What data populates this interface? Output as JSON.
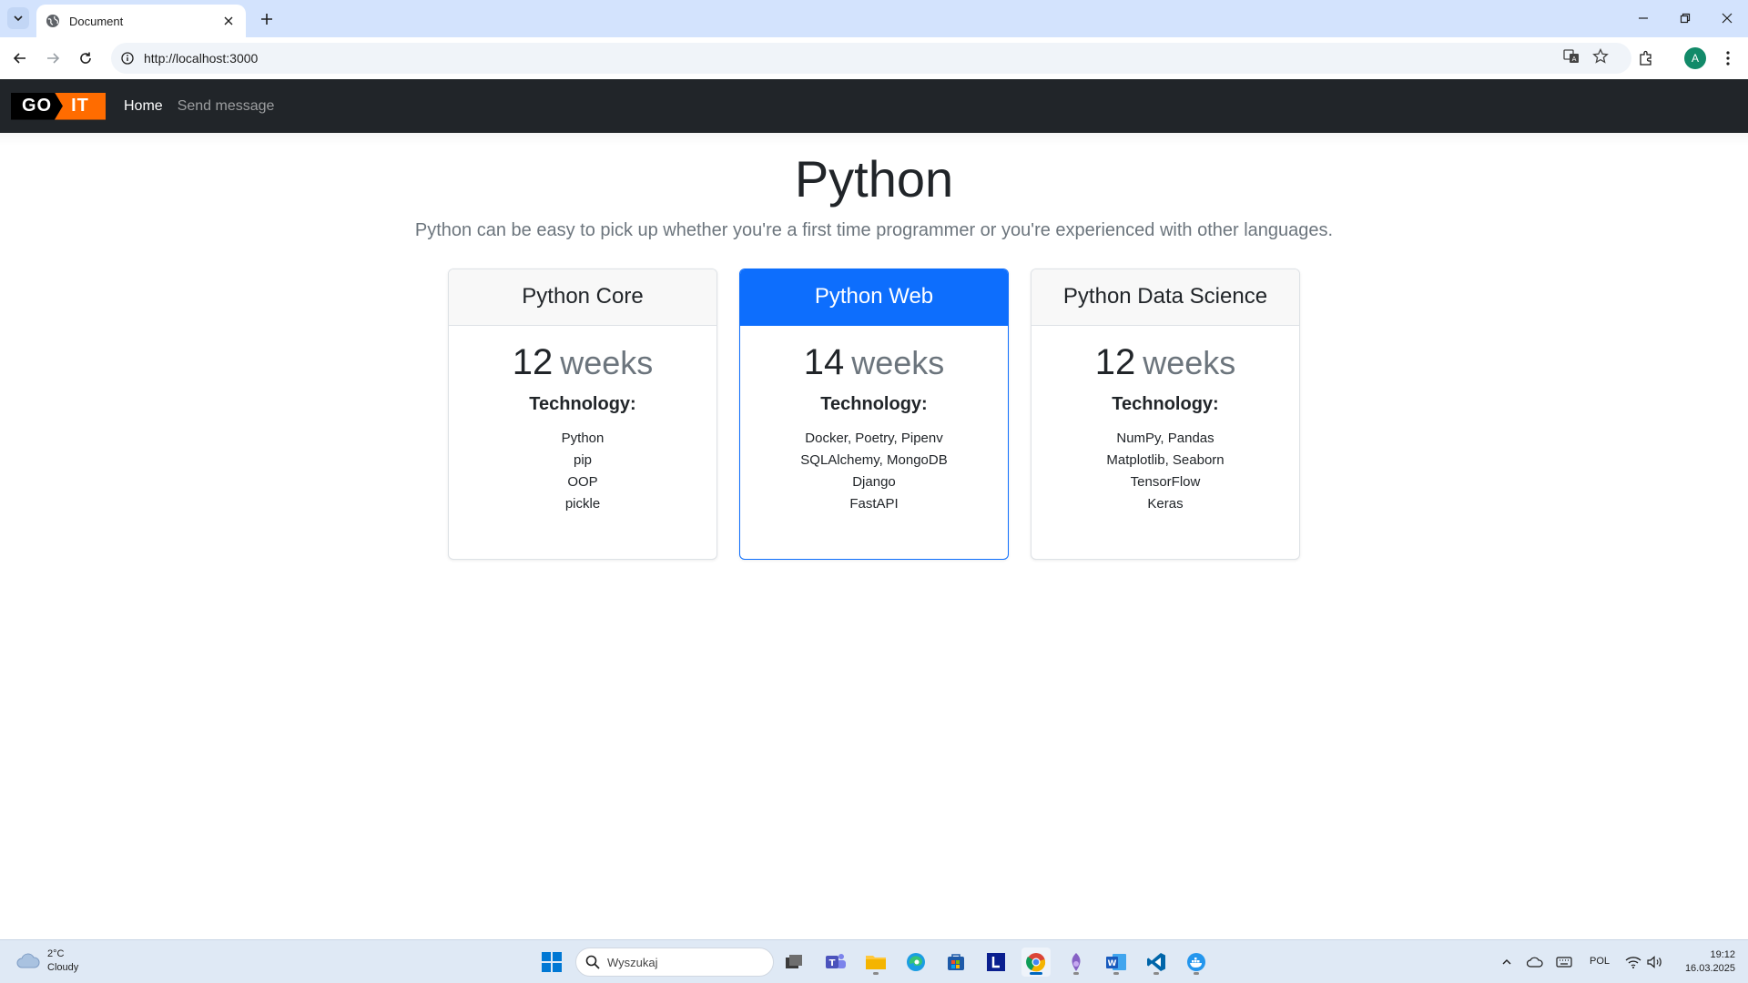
{
  "browser": {
    "tab": {
      "title": "Document"
    },
    "address": {
      "url": "http://localhost:3000"
    }
  },
  "navbar": {
    "logo": {
      "go": "GO",
      "it": "IT"
    },
    "links": [
      {
        "label": "Home",
        "active": true
      },
      {
        "label": "Send message",
        "active": false
      }
    ]
  },
  "hero": {
    "title": "Python",
    "lead": "Python can be easy to pick up whether you're a first time programmer or you're experienced with other languages."
  },
  "cards": [
    {
      "title": "Python Core",
      "duration": "12",
      "unit": "weeks",
      "tech_label": "Technology:",
      "tech": [
        "Python",
        "pip",
        "OOP",
        "pickle"
      ]
    },
    {
      "title": "Python Web",
      "duration": "14",
      "unit": "weeks",
      "tech_label": "Technology:",
      "tech": [
        "Docker, Poetry, Pipenv",
        "SQLAlchemy, MongoDB",
        "Django",
        "FastAPI"
      ],
      "featured": true
    },
    {
      "title": "Python Data Science",
      "duration": "12",
      "unit": "weeks",
      "tech_label": "Technology:",
      "tech": [
        "NumPy, Pandas",
        "Matplotlib, Seaborn",
        "TensorFlow",
        "Keras"
      ]
    }
  ],
  "taskbar": {
    "weather": {
      "temp": "2°C",
      "condition": "Cloudy"
    },
    "search_placeholder": "Wyszukaj",
    "language": "POL",
    "time": "19:12",
    "date": "16.03.2025"
  },
  "colors": {
    "navbar_bg": "#212529",
    "logo_accent": "#ff6c00",
    "featured": "#0d6efd",
    "chrome_tabstrip": "#d3e3fd"
  }
}
